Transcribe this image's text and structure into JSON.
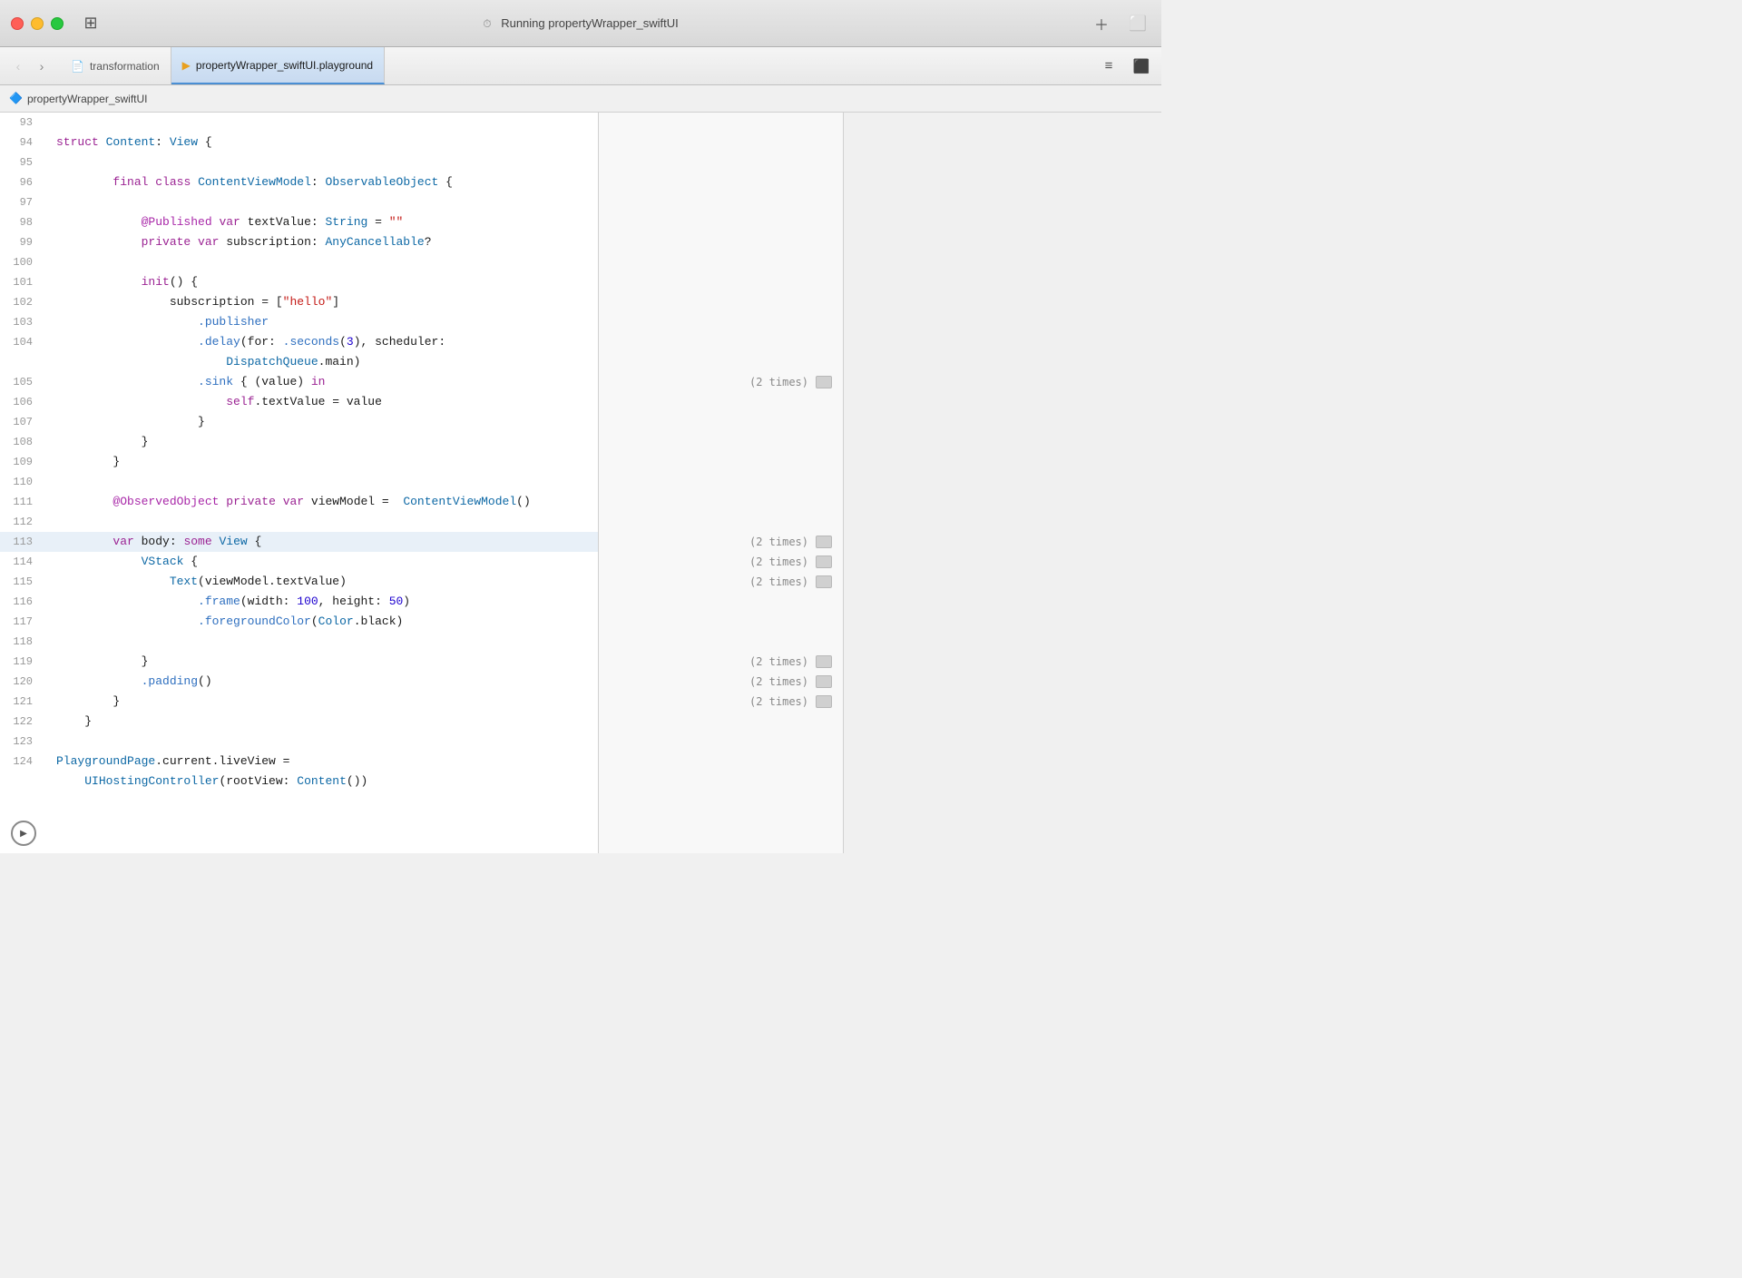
{
  "window": {
    "title": "Running propertyWrapper_swiftUI",
    "controls": {
      "close": "close",
      "minimize": "minimize",
      "maximize": "maximize"
    }
  },
  "toolbar": {
    "tabs": [
      {
        "id": "transformation",
        "label": "transformation",
        "icon": "doc",
        "active": false
      },
      {
        "id": "playground",
        "label": "propertyWrapper_swiftUI.playground",
        "icon": "playground",
        "active": true
      }
    ],
    "right_buttons": [
      "editor-layout",
      "split-view"
    ]
  },
  "breadcrumb": {
    "icon": "swift-icon",
    "text": "propertyWrapper_swiftUI"
  },
  "code_lines": [
    {
      "num": "93",
      "content": "",
      "highlighted": false
    },
    {
      "num": "94",
      "content": "struct Content: View {",
      "highlighted": false,
      "tokens": [
        {
          "text": "struct ",
          "class": "kw"
        },
        {
          "text": "Content",
          "class": "type"
        },
        {
          "text": ": ",
          "class": "plain"
        },
        {
          "text": "View",
          "class": "type"
        },
        {
          "text": " {",
          "class": "plain"
        }
      ]
    },
    {
      "num": "95",
      "content": "",
      "highlighted": false
    },
    {
      "num": "96",
      "content": "        final class ContentViewModel: ObservableObject {",
      "highlighted": false,
      "tokens": [
        {
          "text": "        ",
          "class": "plain"
        },
        {
          "text": "final",
          "class": "kw"
        },
        {
          "text": " ",
          "class": "plain"
        },
        {
          "text": "class",
          "class": "kw"
        },
        {
          "text": " ",
          "class": "plain"
        },
        {
          "text": "ContentViewModel",
          "class": "type"
        },
        {
          "text": ": ",
          "class": "plain"
        },
        {
          "text": "ObservableObject",
          "class": "type"
        },
        {
          "text": " {",
          "class": "plain"
        }
      ]
    },
    {
      "num": "97",
      "content": "",
      "highlighted": false
    },
    {
      "num": "98",
      "content": "            @Published var textValue: String = \"\"",
      "highlighted": false,
      "tokens": [
        {
          "text": "            ",
          "class": "plain"
        },
        {
          "text": "@Published",
          "class": "attr"
        },
        {
          "text": " ",
          "class": "plain"
        },
        {
          "text": "var",
          "class": "kw"
        },
        {
          "text": " textValue: ",
          "class": "plain"
        },
        {
          "text": "String",
          "class": "type"
        },
        {
          "text": " = ",
          "class": "plain"
        },
        {
          "text": "\"\"",
          "class": "str"
        }
      ]
    },
    {
      "num": "99",
      "content": "            private var subscription: AnyCancellable?",
      "highlighted": false,
      "tokens": [
        {
          "text": "            ",
          "class": "plain"
        },
        {
          "text": "private",
          "class": "kw"
        },
        {
          "text": " ",
          "class": "plain"
        },
        {
          "text": "var",
          "class": "kw"
        },
        {
          "text": " subscription: ",
          "class": "plain"
        },
        {
          "text": "AnyCancellable",
          "class": "type"
        },
        {
          "text": "?",
          "class": "plain"
        }
      ]
    },
    {
      "num": "100",
      "content": "",
      "highlighted": false
    },
    {
      "num": "101",
      "content": "            init() {",
      "highlighted": false,
      "tokens": [
        {
          "text": "            ",
          "class": "plain"
        },
        {
          "text": "init",
          "class": "kw"
        },
        {
          "text": "() {",
          "class": "plain"
        }
      ]
    },
    {
      "num": "102",
      "content": "                subscription = [\"hello\"]",
      "highlighted": false,
      "tokens": [
        {
          "text": "                subscription = [",
          "class": "plain"
        },
        {
          "text": "\"hello\"",
          "class": "str"
        },
        {
          "text": "]",
          "class": "plain"
        }
      ]
    },
    {
      "num": "103",
      "content": "                    .publisher",
      "highlighted": false,
      "tokens": [
        {
          "text": "                    ",
          "class": "plain"
        },
        {
          "text": ".publisher",
          "class": "method"
        }
      ]
    },
    {
      "num": "104",
      "content": "                    .delay(for: .seconds(3), scheduler:",
      "highlighted": false,
      "tokens": [
        {
          "text": "                    ",
          "class": "plain"
        },
        {
          "text": ".delay",
          "class": "method"
        },
        {
          "text": "(for: ",
          "class": "plain"
        },
        {
          "text": ".seconds",
          "class": "method"
        },
        {
          "text": "(",
          "class": "plain"
        },
        {
          "text": "3",
          "class": "num"
        },
        {
          "text": "), scheduler:",
          "class": "plain"
        }
      ]
    },
    {
      "num": "",
      "content": "                        DispatchQueue.main)",
      "highlighted": false,
      "tokens": [
        {
          "text": "                        DispatchQueue",
          "class": "type"
        },
        {
          "text": ".main)",
          "class": "plain"
        }
      ]
    },
    {
      "num": "105",
      "content": "                    .sink { (value) in",
      "highlighted": false,
      "tokens": [
        {
          "text": "                    ",
          "class": "plain"
        },
        {
          "text": ".sink",
          "class": "method"
        },
        {
          "text": " { (value) ",
          "class": "plain"
        },
        {
          "text": "in",
          "class": "kw"
        }
      ]
    },
    {
      "num": "106",
      "content": "                        self.textValue = value",
      "highlighted": false,
      "tokens": [
        {
          "text": "                        ",
          "class": "plain"
        },
        {
          "text": "self",
          "class": "kw"
        },
        {
          "text": ".textValue = value",
          "class": "plain"
        }
      ]
    },
    {
      "num": "107",
      "content": "                    }",
      "highlighted": false,
      "tokens": [
        {
          "text": "                    }",
          "class": "plain"
        }
      ]
    },
    {
      "num": "108",
      "content": "            }",
      "highlighted": false,
      "tokens": [
        {
          "text": "            }",
          "class": "plain"
        }
      ]
    },
    {
      "num": "109",
      "content": "        }",
      "highlighted": false,
      "tokens": [
        {
          "text": "        }",
          "class": "plain"
        }
      ]
    },
    {
      "num": "110",
      "content": "",
      "highlighted": false
    },
    {
      "num": "111",
      "content": "        @ObservedObject private var viewModel =  ContentViewModel()",
      "highlighted": false,
      "tokens": [
        {
          "text": "        ",
          "class": "plain"
        },
        {
          "text": "@ObservedObject",
          "class": "attr"
        },
        {
          "text": " ",
          "class": "plain"
        },
        {
          "text": "private",
          "class": "kw"
        },
        {
          "text": " ",
          "class": "plain"
        },
        {
          "text": "var",
          "class": "kw"
        },
        {
          "text": " viewModel =  ",
          "class": "plain"
        },
        {
          "text": "ContentViewModel",
          "class": "type"
        },
        {
          "text": "()",
          "class": "plain"
        }
      ]
    },
    {
      "num": "112",
      "content": "",
      "highlighted": false
    },
    {
      "num": "113",
      "content": "        var body: some View {",
      "highlighted": true,
      "tokens": [
        {
          "text": "        ",
          "class": "plain"
        },
        {
          "text": "var",
          "class": "kw"
        },
        {
          "text": " body: ",
          "class": "plain"
        },
        {
          "text": "some",
          "class": "kw"
        },
        {
          "text": " ",
          "class": "plain"
        },
        {
          "text": "View",
          "class": "type"
        },
        {
          "text": " {",
          "class": "plain"
        }
      ]
    },
    {
      "num": "114",
      "content": "            VStack {",
      "highlighted": false,
      "tokens": [
        {
          "text": "            ",
          "class": "plain"
        },
        {
          "text": "VStack",
          "class": "type"
        },
        {
          "text": " {",
          "class": "plain"
        }
      ]
    },
    {
      "num": "115",
      "content": "                Text(viewModel.textValue)",
      "highlighted": false,
      "tokens": [
        {
          "text": "                ",
          "class": "plain"
        },
        {
          "text": "Text",
          "class": "type"
        },
        {
          "text": "(viewModel.textValue)",
          "class": "plain"
        }
      ]
    },
    {
      "num": "116",
      "content": "                    .frame(width: 100, height: 50)",
      "highlighted": false,
      "tokens": [
        {
          "text": "                    ",
          "class": "plain"
        },
        {
          "text": ".frame",
          "class": "method"
        },
        {
          "text": "(width: ",
          "class": "plain"
        },
        {
          "text": "100",
          "class": "num"
        },
        {
          "text": ", height: ",
          "class": "plain"
        },
        {
          "text": "50",
          "class": "num"
        },
        {
          "text": ")",
          "class": "plain"
        }
      ]
    },
    {
      "num": "117",
      "content": "                    .foregroundColor(Color.black)",
      "highlighted": false,
      "tokens": [
        {
          "text": "                    ",
          "class": "plain"
        },
        {
          "text": ".foregroundColor",
          "class": "method"
        },
        {
          "text": "(",
          "class": "plain"
        },
        {
          "text": "Color",
          "class": "type"
        },
        {
          "text": ".black)",
          "class": "plain"
        }
      ]
    },
    {
      "num": "118",
      "content": "",
      "highlighted": false
    },
    {
      "num": "119",
      "content": "            }",
      "highlighted": false,
      "tokens": [
        {
          "text": "            }",
          "class": "plain"
        }
      ]
    },
    {
      "num": "120",
      "content": "            .padding()",
      "highlighted": false,
      "tokens": [
        {
          "text": "            ",
          "class": "plain"
        },
        {
          "text": ".padding",
          "class": "method"
        },
        {
          "text": "()",
          "class": "plain"
        }
      ]
    },
    {
      "num": "121",
      "content": "        }",
      "highlighted": false,
      "tokens": [
        {
          "text": "        }",
          "class": "plain"
        }
      ]
    },
    {
      "num": "122",
      "content": "    }",
      "highlighted": false,
      "tokens": [
        {
          "text": "    }",
          "class": "plain"
        }
      ]
    },
    {
      "num": "123",
      "content": "",
      "highlighted": false
    },
    {
      "num": "124",
      "content": "PlaygroundPage.current.liveView =",
      "highlighted": false,
      "tokens": [
        {
          "text": "PlaygroundPage",
          "class": "type"
        },
        {
          "text": ".current.liveView =",
          "class": "plain"
        }
      ]
    },
    {
      "num": "",
      "content": "    UIHostingController(rootView: Content())",
      "highlighted": false,
      "tokens": [
        {
          "text": "    ",
          "class": "plain"
        },
        {
          "text": "UIHostingController",
          "class": "type"
        },
        {
          "text": "(rootView: ",
          "class": "plain"
        },
        {
          "text": "Content",
          "class": "type"
        },
        {
          "text": "())",
          "class": "plain"
        }
      ]
    }
  ],
  "results": {
    "lines": {
      "105": {
        "text": "(2 times)",
        "thumb": true
      },
      "113": {
        "text": "(2 times)",
        "thumb": true
      },
      "114": {
        "text": "(2 times)",
        "thumb": true
      },
      "115": {
        "text": "(2 times)",
        "thumb": true
      },
      "119": {
        "text": "(2 times)",
        "thumb": true
      },
      "120": {
        "text": "(2 times)",
        "thumb": true
      },
      "121": {
        "text": "(2 times)",
        "thumb": true
      }
    }
  },
  "play_button_label": "▶"
}
